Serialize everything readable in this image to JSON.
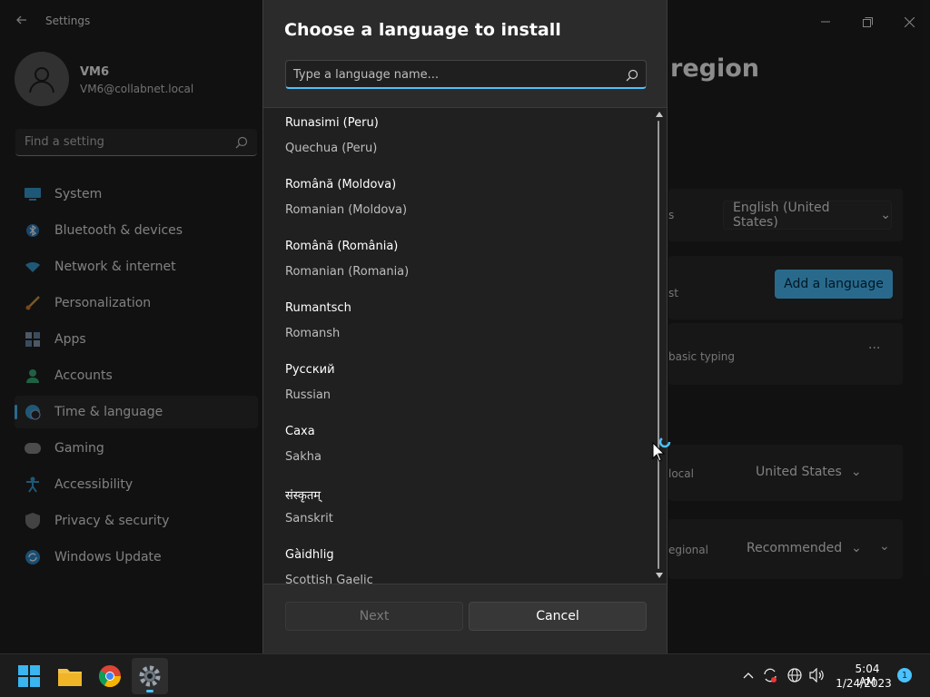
{
  "settings": {
    "app_title": "Settings",
    "user": {
      "name": "VM6",
      "email": "VM6@collabnet.local"
    },
    "search_placeholder": "Find a setting",
    "nav": [
      {
        "label": "System",
        "icon": "monitor-icon",
        "active": false
      },
      {
        "label": "Bluetooth & devices",
        "icon": "bluetooth-icon",
        "active": false
      },
      {
        "label": "Network & internet",
        "icon": "wifi-icon",
        "active": false
      },
      {
        "label": "Personalization",
        "icon": "brush-icon",
        "active": false
      },
      {
        "label": "Apps",
        "icon": "apps-icon",
        "active": false
      },
      {
        "label": "Accounts",
        "icon": "person-icon",
        "active": false
      },
      {
        "label": "Time & language",
        "icon": "globe-clock-icon",
        "active": true
      },
      {
        "label": "Gaming",
        "icon": "gamepad-icon",
        "active": false
      },
      {
        "label": "Accessibility",
        "icon": "accessibility-icon",
        "active": false
      },
      {
        "label": "Privacy & security",
        "icon": "shield-icon",
        "active": false
      },
      {
        "label": "Windows Update",
        "icon": "update-icon",
        "active": false
      }
    ],
    "page_title_fragment": "region",
    "rows": {
      "display_lang_suffix": "s",
      "display_lang_value": "English (United States)",
      "add_language_label": "Add a language",
      "pref_suffix": "st",
      "typing_text": "basic typing",
      "more_label": "···",
      "country_suffix": "local",
      "country_value": "United States",
      "format_suffix": "egional",
      "format_value": "Recommended"
    }
  },
  "dialog": {
    "title": "Choose a language to install",
    "search_placeholder": "Type a language name...",
    "languages": [
      {
        "native": "Runasimi (Peru)",
        "english": "Quechua (Peru)"
      },
      {
        "native": "Română (Moldova)",
        "english": "Romanian (Moldova)"
      },
      {
        "native": "Română (România)",
        "english": "Romanian (Romania)"
      },
      {
        "native": "Rumantsch",
        "english": "Romansh"
      },
      {
        "native": "Русский",
        "english": "Russian"
      },
      {
        "native": "Саха",
        "english": "Sakha"
      },
      {
        "native": "संस्कृतम्",
        "english": "Sanskrit"
      },
      {
        "native": "Gàidhlig",
        "english": "Scottish Gaelic"
      }
    ],
    "next_label": "Next",
    "cancel_label": "Cancel"
  },
  "taskbar": {
    "apps": [
      "windows-start-icon",
      "file-explorer-icon",
      "chrome-icon",
      "settings-icon"
    ],
    "time": "5:04 AM",
    "date": "1/24/2023",
    "notification_count": "1"
  },
  "colors": {
    "accent": "#4cc2ff",
    "surface": "#2b2b2b",
    "background": "#202020"
  }
}
